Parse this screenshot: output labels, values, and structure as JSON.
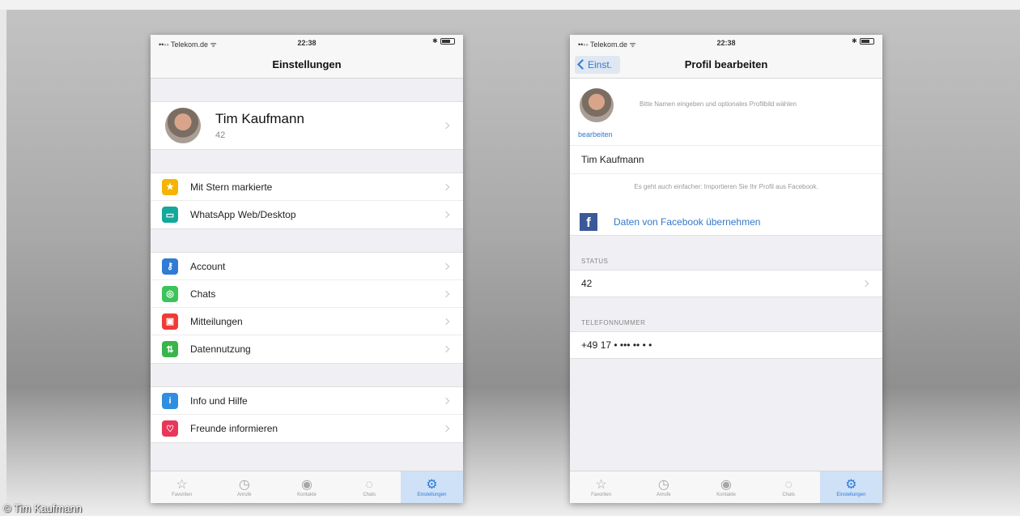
{
  "credit": "© Tim Kaufmann",
  "status": {
    "carrier": "••◦◦ Telekom.de ᯤ",
    "time": "22:38",
    "bt": "✱"
  },
  "left": {
    "title": "Einstellungen",
    "profile": {
      "name": "Tim Kaufmann",
      "status": "42"
    },
    "group1": [
      {
        "label": "Mit Stern markierte",
        "icon": "star-icon",
        "color": "#f4b400",
        "glyph": "★"
      },
      {
        "label": "WhatsApp Web/Desktop",
        "icon": "laptop-icon",
        "color": "#14a89b",
        "glyph": "▭"
      }
    ],
    "group2": [
      {
        "label": "Account",
        "icon": "key-icon",
        "color": "#2f7bd6",
        "glyph": "⚷"
      },
      {
        "label": "Chats",
        "icon": "whatsapp-icon",
        "color": "#3cc35a",
        "glyph": "◎"
      },
      {
        "label": "Mitteilungen",
        "icon": "notification-icon",
        "color": "#ef3b36",
        "glyph": "▣"
      },
      {
        "label": "Datennutzung",
        "icon": "data-arrows-icon",
        "color": "#39b54a",
        "glyph": "⇅"
      }
    ],
    "group3": [
      {
        "label": "Info und Hilfe",
        "icon": "info-icon",
        "color": "#2f8ee0",
        "glyph": "i"
      },
      {
        "label": "Freunde informieren",
        "icon": "heart-icon",
        "color": "#e8375a",
        "glyph": "♡"
      }
    ]
  },
  "right": {
    "back": "Einst.",
    "title": "Profil bearbeiten",
    "edit_link": "bearbeiten",
    "hint": "Bitte Namen eingeben und optionales Profilbild wählen",
    "name_value": "Tim Kaufmann",
    "fb_note": "Es geht auch einfacher: Importieren Sie Ihr Profil aus Facebook.",
    "fb_label": "Daten von Facebook übernehmen",
    "status_header": "STATUS",
    "status_value": "42",
    "phone_header": "TELEFONNUMMER",
    "phone_value": "+49 17 • ••• •• • •"
  },
  "tabs": [
    {
      "label": "Favoriten",
      "icon": "star-outline-icon",
      "glyph": "☆"
    },
    {
      "label": "Anrufe",
      "icon": "clock-icon",
      "glyph": "◷"
    },
    {
      "label": "Kontakte",
      "icon": "contacts-icon",
      "glyph": "◉"
    },
    {
      "label": "Chats",
      "icon": "chat-bubbles-icon",
      "glyph": "◌"
    },
    {
      "label": "Einstellungen",
      "icon": "settings-gear-icon",
      "glyph": "⚙"
    }
  ]
}
